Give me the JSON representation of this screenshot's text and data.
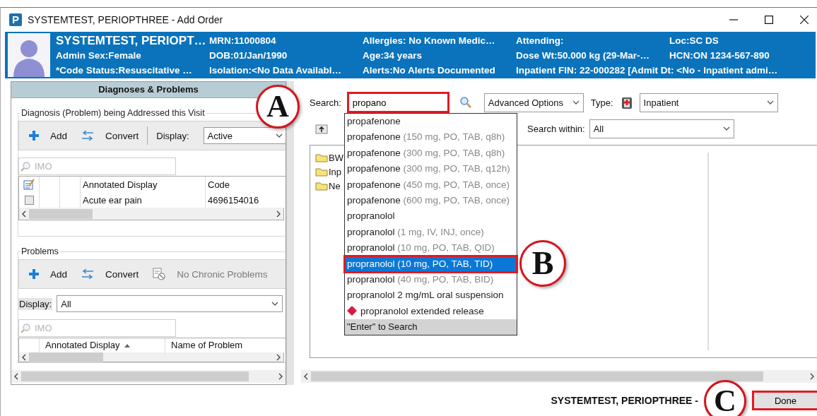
{
  "window": {
    "icon_letter": "P",
    "title": "SYSTEMTEST, PERIOPTHREE - Add Order"
  },
  "banner": {
    "rows": [
      [
        "SYSTEMTEST, PERIOPT…",
        "MRN:11000804",
        "Allergies: No Known Medic…",
        "Attending:",
        "Loc:SC DS"
      ],
      [
        "Admin Sex:Female",
        "DOB:01/Jan/1990",
        "Age:34 years",
        "Dose Wt:50.000 kg (29-Mar-…",
        "HCN:ON 1234-567-890"
      ],
      [
        "*Code Status:Resuscitative …",
        "Isolation:<No Data Availabl…",
        "Alerts:No Alerts Documented",
        "Inpatient FIN: 22-000282 [Admit Dt: <No - Inpatient admi…"
      ]
    ]
  },
  "left_panel": {
    "title": "Diagnoses & Problems",
    "groups": [
      {
        "kind": "diagnosis",
        "title": "Diagnosis (Problem) being Addressed this Visit",
        "toolbar": [
          {
            "kind": "add",
            "label": "Add",
            "disabled": false
          },
          {
            "kind": "convert",
            "label": "Convert",
            "disabled": false
          }
        ],
        "display_label": "Display:",
        "display_value": "Active",
        "filter_placeholder": "IMO",
        "columns": [
          {
            "label": "Annotated Display",
            "sorted": false
          },
          {
            "label": "Code",
            "sorted": false
          }
        ],
        "rows": [
          {
            "checked": false,
            "cells": [
              "Acute ear pain",
              "4696154016"
            ]
          }
        ]
      },
      {
        "kind": "problems",
        "title": "Problems",
        "toolbar": [
          {
            "kind": "add",
            "label": "Add",
            "disabled": false
          },
          {
            "kind": "convert",
            "label": "Convert",
            "disabled": false
          },
          {
            "kind": "no-chronic",
            "label": "No Chronic Problems",
            "disabled": true
          }
        ],
        "display_label": "Display:",
        "display_value": "All",
        "filter_placeholder": "IMO",
        "columns": [
          {
            "label": "Annotated Display",
            "sorted": true
          },
          {
            "label": "Name of Problem",
            "sorted": false
          }
        ]
      }
    ]
  },
  "order_search": {
    "search_label": "Search:",
    "search_value": "propano",
    "search_highlighted": true,
    "advanced_options": "Advanced Options",
    "type_label": "Type:",
    "type_value": "Inpatient",
    "search_within_label": "Search within:",
    "search_within_value": "All",
    "folders": [
      "BW",
      "Inp",
      "Ne"
    ],
    "suggestions": [
      {
        "name": "propafenone",
        "selected": false,
        "flagged": false
      },
      {
        "name": "propafenone",
        "detail": "(150 mg, PO, TAB, q8h)",
        "selected": false,
        "flagged": false
      },
      {
        "name": "propafenone",
        "detail": "(300 mg, PO, TAB, q8h)",
        "selected": false,
        "flagged": false
      },
      {
        "name": "propafenone",
        "detail": "(300 mg, PO, TAB, q12h)",
        "selected": false,
        "flagged": false
      },
      {
        "name": "propafenone",
        "detail": "(450 mg, PO, TAB, once)",
        "selected": false,
        "flagged": false
      },
      {
        "name": "propafenone",
        "detail": "(600 mg, PO, TAB, once)",
        "selected": false,
        "flagged": false
      },
      {
        "name": "propranolol",
        "selected": false,
        "flagged": false
      },
      {
        "name": "propranolol",
        "detail": "(1 mg, IV, INJ, once)",
        "selected": false,
        "flagged": false
      },
      {
        "name": "propranolol",
        "detail": "(10 mg, PO, TAB, QID)",
        "selected": false,
        "flagged": false
      },
      {
        "name": "propranolol",
        "detail": "(10 mg, PO, TAB, TID)",
        "selected": true,
        "flagged": false
      },
      {
        "name": "propranolol",
        "detail": "(40 mg, PO, TAB, BID)",
        "selected": false,
        "flagged": false
      },
      {
        "name": "propranolol 2 mg/mL oral suspension",
        "selected": false,
        "flagged": false
      },
      {
        "name": "propranolol extended release",
        "selected": false,
        "flagged": true
      }
    ],
    "suggestions_footer": "\"Enter\" to Search"
  },
  "footer": {
    "patient_name": "SYSTEMTEST, PERIOPTHREE -",
    "done_label": "Done",
    "done_highlighted": true
  },
  "callouts": [
    {
      "label": "A"
    },
    {
      "label": "B"
    },
    {
      "label": "C"
    }
  ]
}
